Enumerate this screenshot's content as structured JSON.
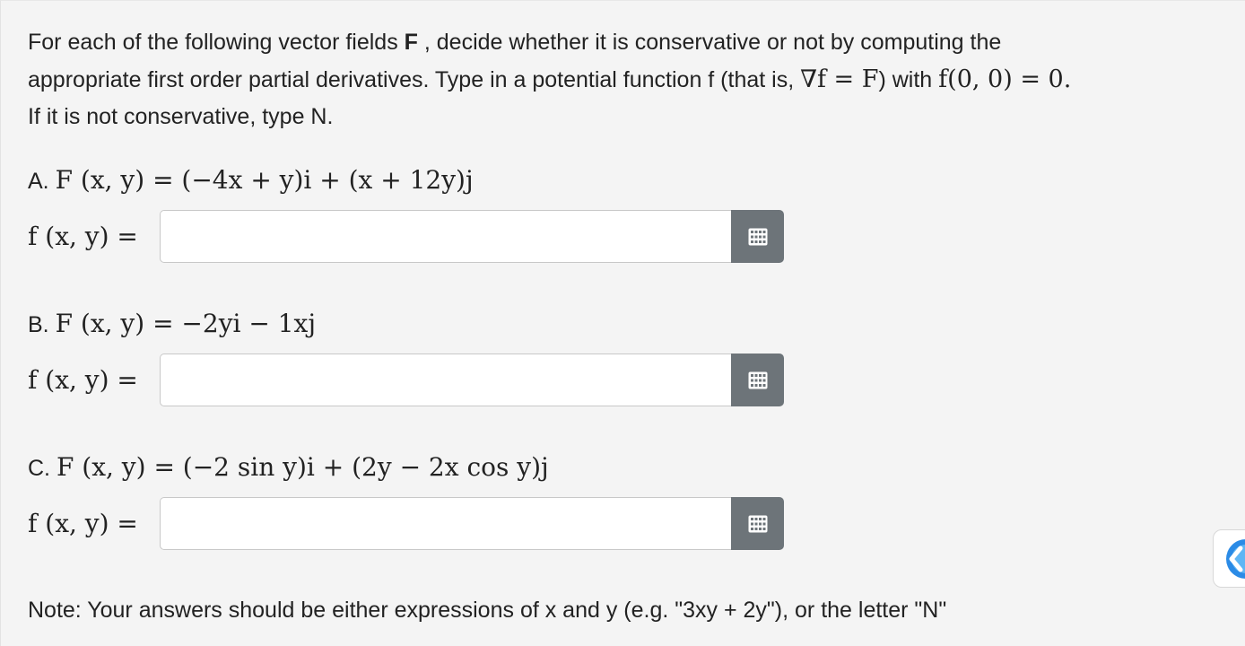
{
  "intro": {
    "line1": "For each of the following vector fields ",
    "line1_bold": "F",
    "line1_rest": " , decide whether it is conservative or not by computing the",
    "line2_start": "appropriate first order partial derivatives. Type in a potential function f (that is, ",
    "line2_math1": "∇f = F",
    "line2_mid": ") with ",
    "line2_math2": "f(0, 0) = 0.",
    "line3": "If it is not conservative, type N."
  },
  "questions": [
    {
      "letter": "A.",
      "field": "F (x, y) = (−4x + y)i + (x + 12y)j",
      "f_label": "f (x, y) =",
      "value": ""
    },
    {
      "letter": "B.",
      "field": "F (x, y) = −2yi − 1xj",
      "f_label": "f (x, y) =",
      "value": ""
    },
    {
      "letter": "C.",
      "field": "F (x, y) = (−2 sin y)i + (2y − 2x cos y)j",
      "f_label": "f (x, y) =",
      "value": ""
    }
  ],
  "note": "Note: Your answers should be either expressions of x and y (e.g. \"3xy + 2y\"), or the letter \"N\"",
  "icons": {
    "keyboard": "keyboard-grid-icon",
    "widget": "assistant-widget-icon"
  },
  "colors": {
    "button": "#6d7479",
    "background": "#f4f4f4",
    "widget_blue": "#2b8be6"
  }
}
